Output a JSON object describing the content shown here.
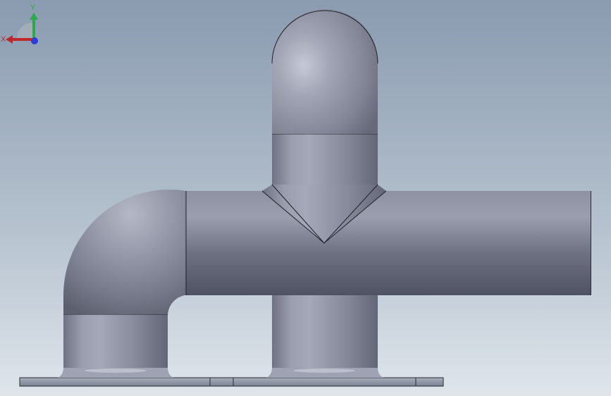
{
  "viewport": {
    "background_top": "#8b9cb0",
    "background_bottom": "#dde4ea",
    "model_color": "#8a8e9e",
    "edge_color": "#1f2128"
  },
  "triad": {
    "x_label": "X",
    "y_label": "Y",
    "x_color": "#c0262a",
    "y_color": "#2ea84a",
    "z_color": "#2b3fd6"
  }
}
